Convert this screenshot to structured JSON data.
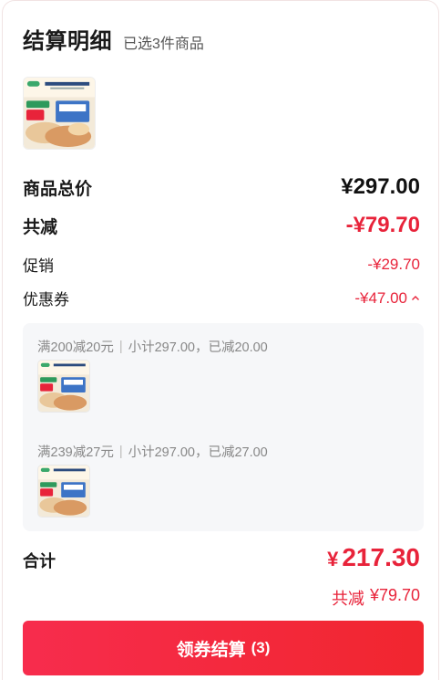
{
  "header": {
    "title": "结算明细",
    "subtitle": "已选3件商品"
  },
  "summary": {
    "goods_total_label": "商品总价",
    "goods_total_value": "¥297.00",
    "total_cut_label": "共减",
    "total_cut_value": "-¥79.70",
    "promo_label": "促销",
    "promo_value": "-¥29.70",
    "coupon_label": "优惠券",
    "coupon_value": "-¥47.00"
  },
  "coupons": [
    {
      "rule": "满200减20元",
      "detail": "小计297.00，已减20.00"
    },
    {
      "rule": "满239减27元",
      "detail": "小计297.00，已减27.00"
    }
  ],
  "footer": {
    "sum_label": "合计",
    "currency": "¥",
    "sum_value": "217.30",
    "cut_label": "共减",
    "cut_value": "¥79.70",
    "checkout_label": "领券结算",
    "checkout_count": "(3)"
  },
  "colors": {
    "accent": "#e8233a",
    "button": "#f1262f",
    "panel": "#f6f7f9"
  },
  "icons": {
    "coupon_toggle": "chevron-up-icon",
    "product": "product-thumbnail"
  }
}
